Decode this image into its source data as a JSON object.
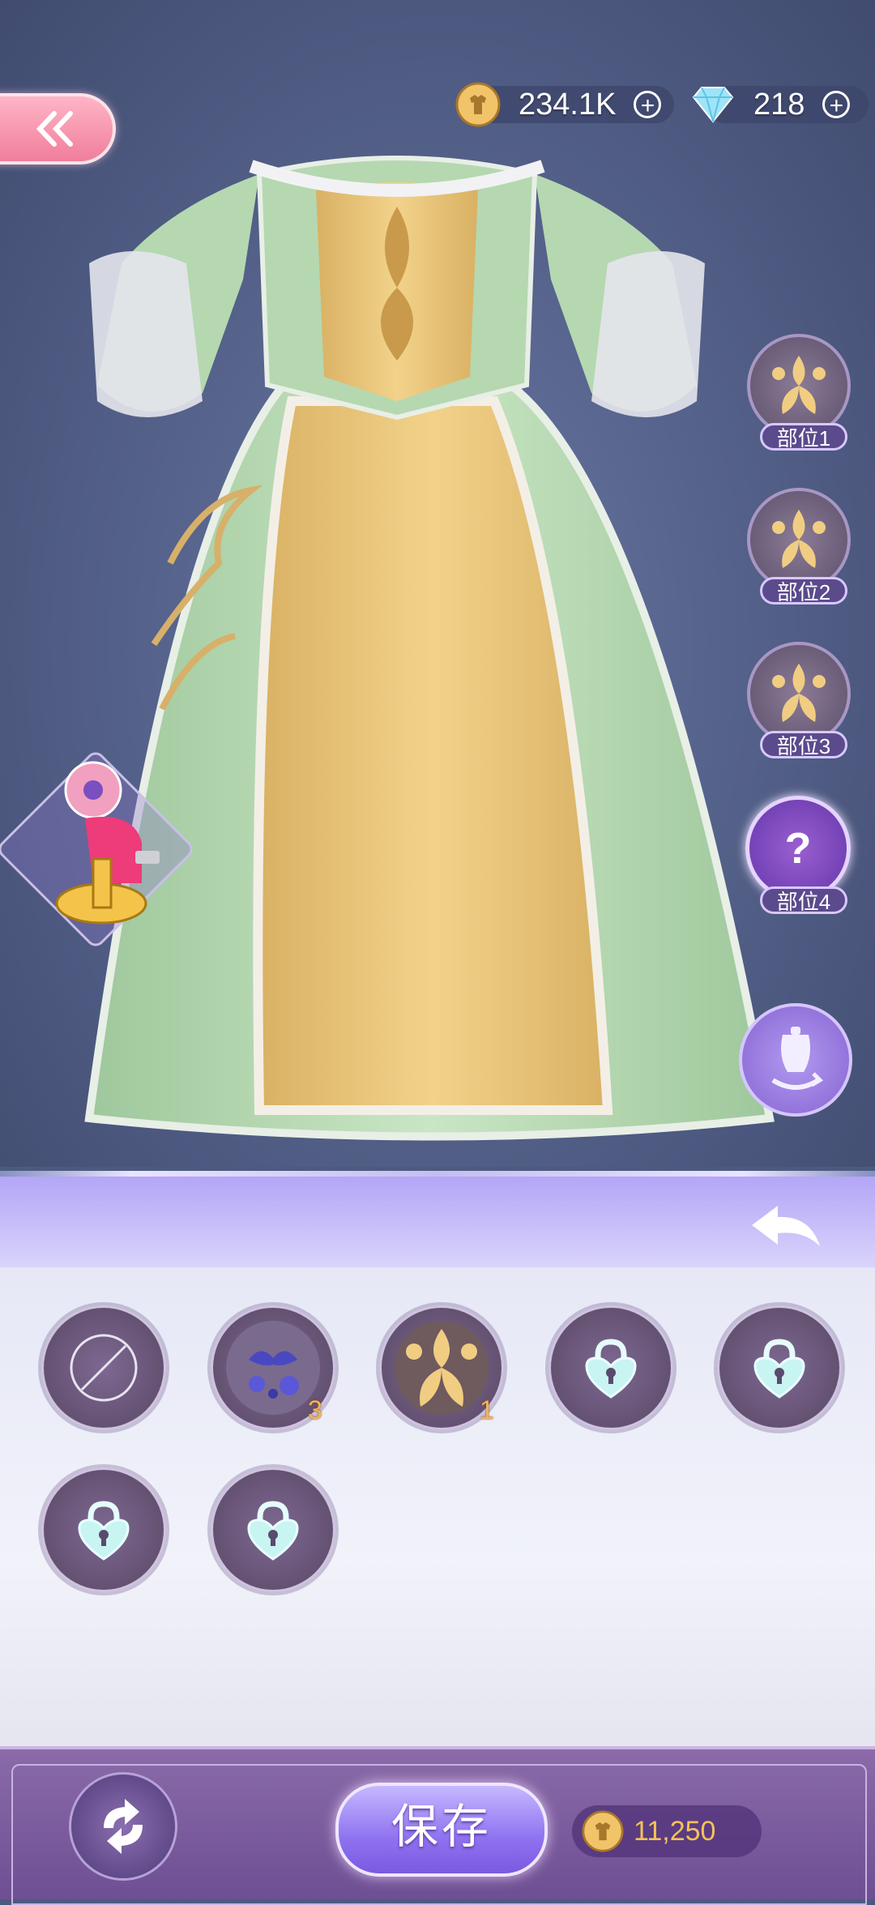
{
  "currency": {
    "coins": "234.1K",
    "diamonds": "218"
  },
  "parts": [
    {
      "label": "部位1",
      "state": "pattern"
    },
    {
      "label": "部位2",
      "state": "pattern"
    },
    {
      "label": "部位3",
      "state": "pattern"
    },
    {
      "label": "部位4",
      "state": "unknown",
      "symbol": "?"
    }
  ],
  "pattern_slots": [
    {
      "icon": "none-icon",
      "count": ""
    },
    {
      "icon": "blue-floral-pattern-icon",
      "count": "3"
    },
    {
      "icon": "gold-damask-pattern-icon",
      "count": "1"
    },
    {
      "icon": "lock-icon",
      "count": ""
    },
    {
      "icon": "lock-icon",
      "count": ""
    },
    {
      "icon": "lock-icon",
      "count": ""
    },
    {
      "icon": "lock-icon",
      "count": ""
    }
  ],
  "footer": {
    "save_label": "保存",
    "cost": "11,250"
  },
  "colors": {
    "accent_purple": "#8f72f0",
    "back_pink": "#f07e9b",
    "dress_green": "#b6d8b0",
    "dress_gold": "#ecc87a"
  }
}
